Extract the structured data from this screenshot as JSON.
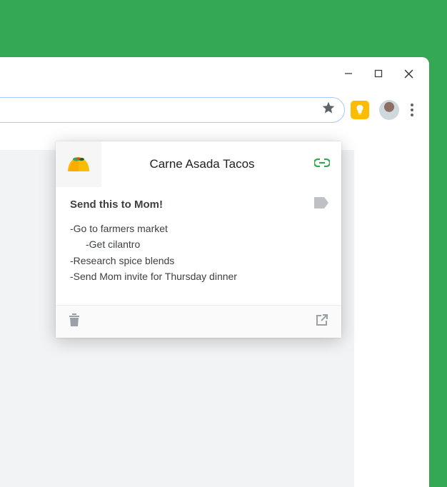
{
  "popup": {
    "title": "Carne Asada Tacos",
    "note_title": "Send this to Mom!",
    "lines": [
      "-Go to farmers market",
      "-Get cilantro",
      "-Research spice blends",
      "-Send Mom invite for Thursday dinner"
    ]
  }
}
